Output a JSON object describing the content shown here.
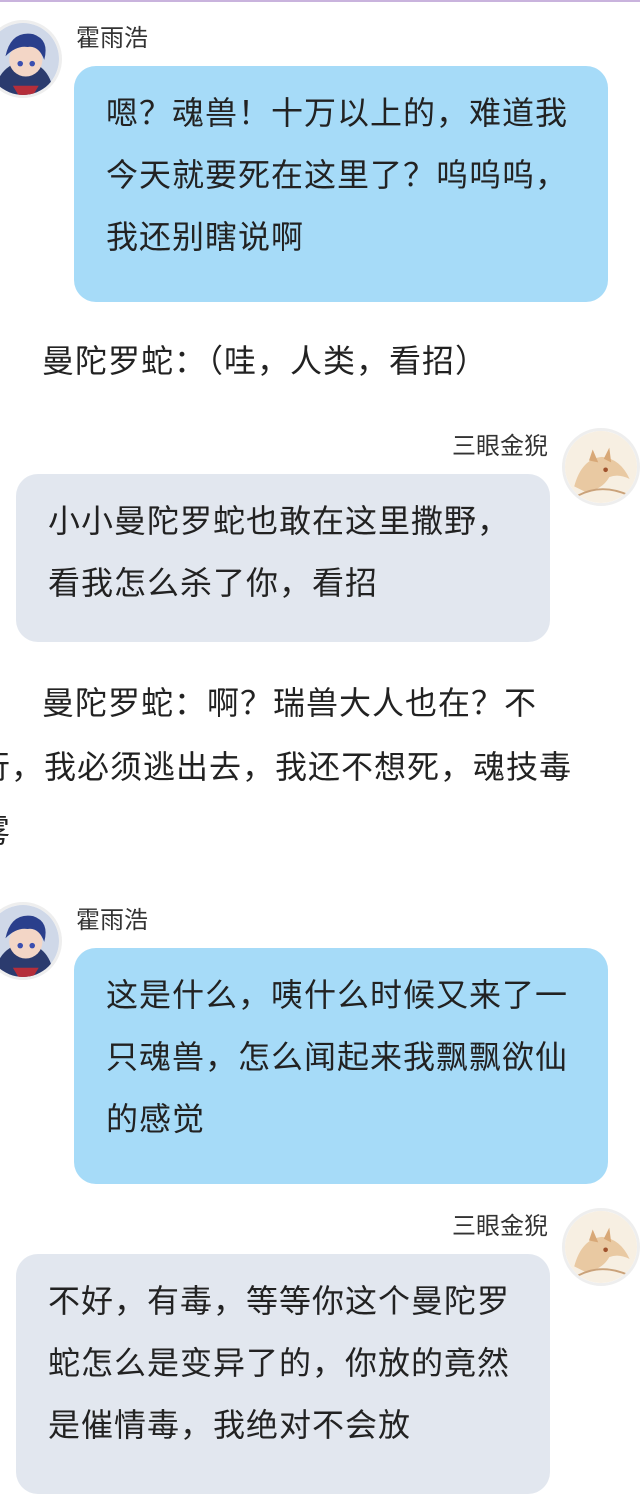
{
  "messages": [
    {
      "speaker": "霍雨浩",
      "side": "left",
      "text": "嗯？魂兽！十万以上的，难道我今天就要死在这里了？呜呜呜，我还别瞎说啊"
    },
    {
      "narration": "曼陀罗蛇：（哇，人类，看招）"
    },
    {
      "speaker": "三眼金猊",
      "side": "right",
      "text": "小小曼陀罗蛇也敢在这里撒野，看我怎么杀了你，看招"
    },
    {
      "narration_lines": [
        "曼陀罗蛇：啊？瑞兽大人也在？不",
        "行，我必须逃出去，我还不想死，魂技毒",
        "雾"
      ]
    },
    {
      "speaker": "霍雨浩",
      "side": "left",
      "text": "这是什么，咦什么时候又来了一只魂兽，怎么闻起来我飘飘欲仙的感觉"
    },
    {
      "speaker": "三眼金猊",
      "side": "right",
      "text": "不好，有毒，等等你这个曼陀罗蛇怎么是变异了的，你放的竟然是催情毒，我绝对不会放"
    }
  ],
  "colors": {
    "blue_bubble": "#a6dbf8",
    "gray_bubble": "#e2e7ef",
    "accent_line": "#c9b3dd"
  },
  "icons": {
    "huo_avatar": "anime-boy-avatar",
    "jinni_avatar": "golden-beast-avatar"
  }
}
